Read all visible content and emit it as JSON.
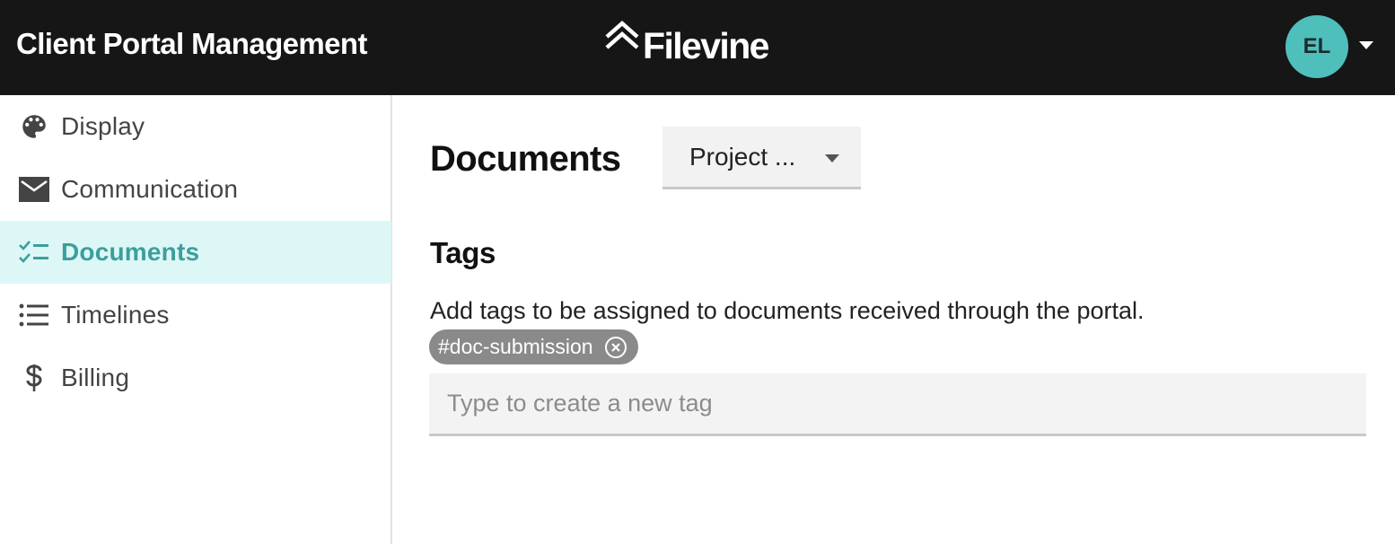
{
  "header": {
    "app_title": "Client Portal Management",
    "brand_name": "Filevine",
    "brand_icon": "double-chevron-up-icon",
    "user_initials": "EL",
    "avatar_color": "#4fbfbc"
  },
  "sidebar": {
    "items": [
      {
        "label": "Display",
        "icon": "palette-icon",
        "active": false
      },
      {
        "label": "Communication",
        "icon": "envelope-icon",
        "active": false
      },
      {
        "label": "Documents",
        "icon": "checklist-icon",
        "active": true
      },
      {
        "label": "Timelines",
        "icon": "list-icon",
        "active": false
      },
      {
        "label": "Billing",
        "icon": "dollar-icon",
        "active": false
      }
    ],
    "active_color": "#3c9f9c",
    "active_background": "#ddf7f7"
  },
  "main": {
    "title": "Documents",
    "project_select": {
      "value": "Project ..."
    },
    "tags_section": {
      "title": "Tags",
      "description": "Add tags to be assigned to documents received through the portal.",
      "tags": [
        {
          "label": "#doc-submission"
        }
      ],
      "input_placeholder": "Type to create a new tag",
      "input_value": ""
    }
  }
}
